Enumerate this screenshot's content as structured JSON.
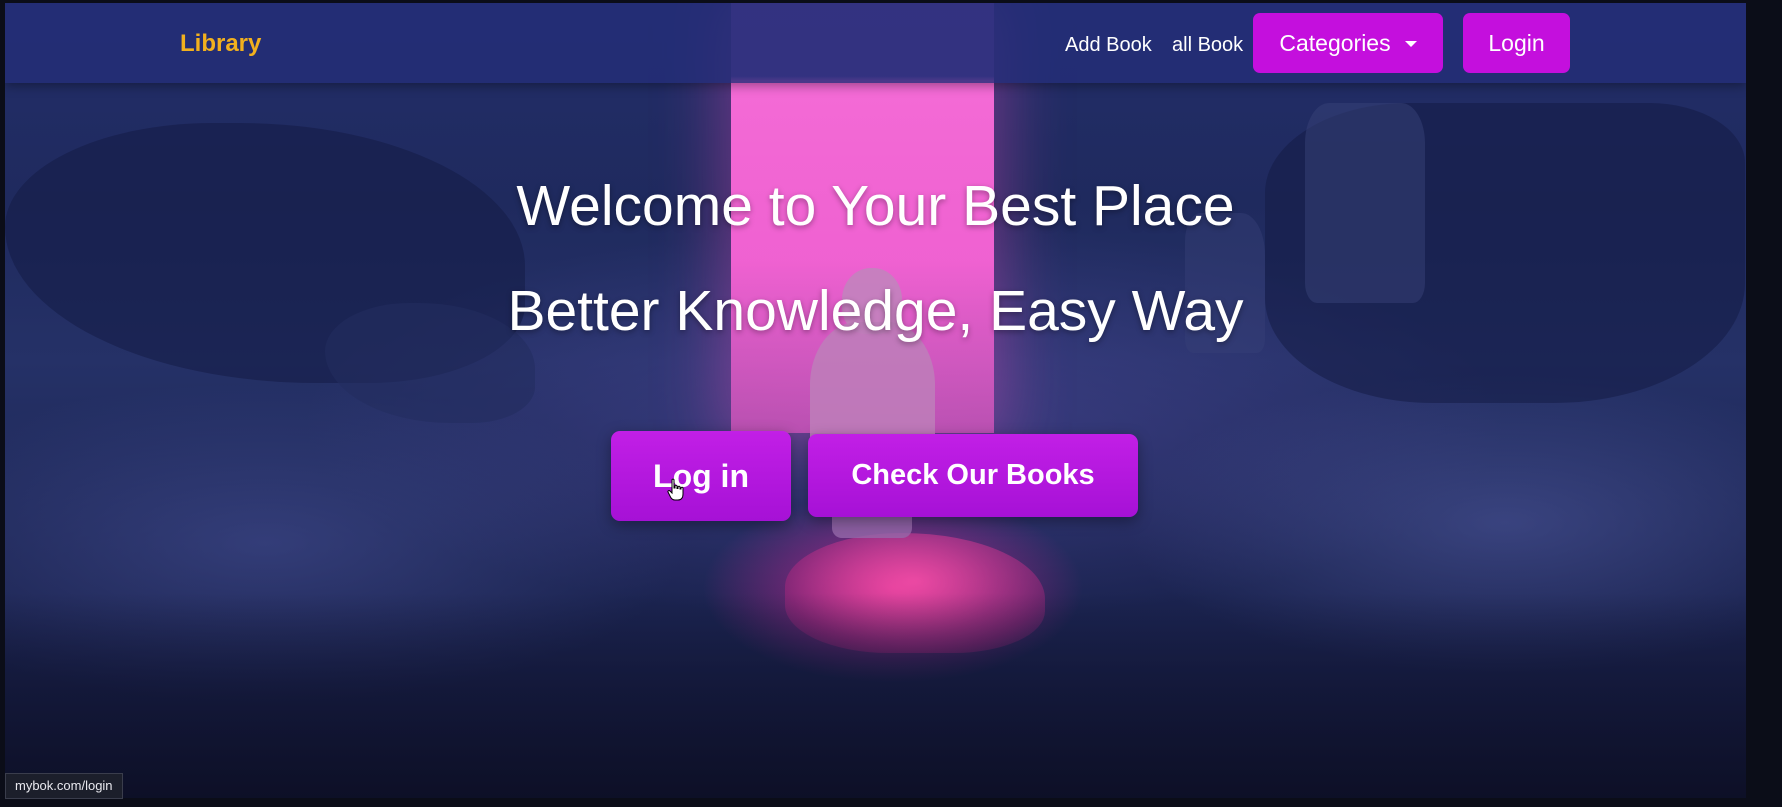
{
  "navbar": {
    "brand": "Library",
    "links": {
      "add_book": "Add Book",
      "all_book": "all Book"
    },
    "categories_label": "Categories",
    "login_label": "Login"
  },
  "hero": {
    "title": "Welcome to Your Best Place",
    "subtitle": "Better Knowledge, Easy Way",
    "login_button": "Log in",
    "books_button": "Check Our Books"
  },
  "status_bar": {
    "url": "mybok.com/login"
  },
  "colors": {
    "brand": "#f2b01e",
    "accent": "#c40fdd",
    "navbar": "#232d78"
  },
  "icons": {
    "dropdown": "caret-down-icon",
    "cursor": "hand-pointer-icon"
  }
}
